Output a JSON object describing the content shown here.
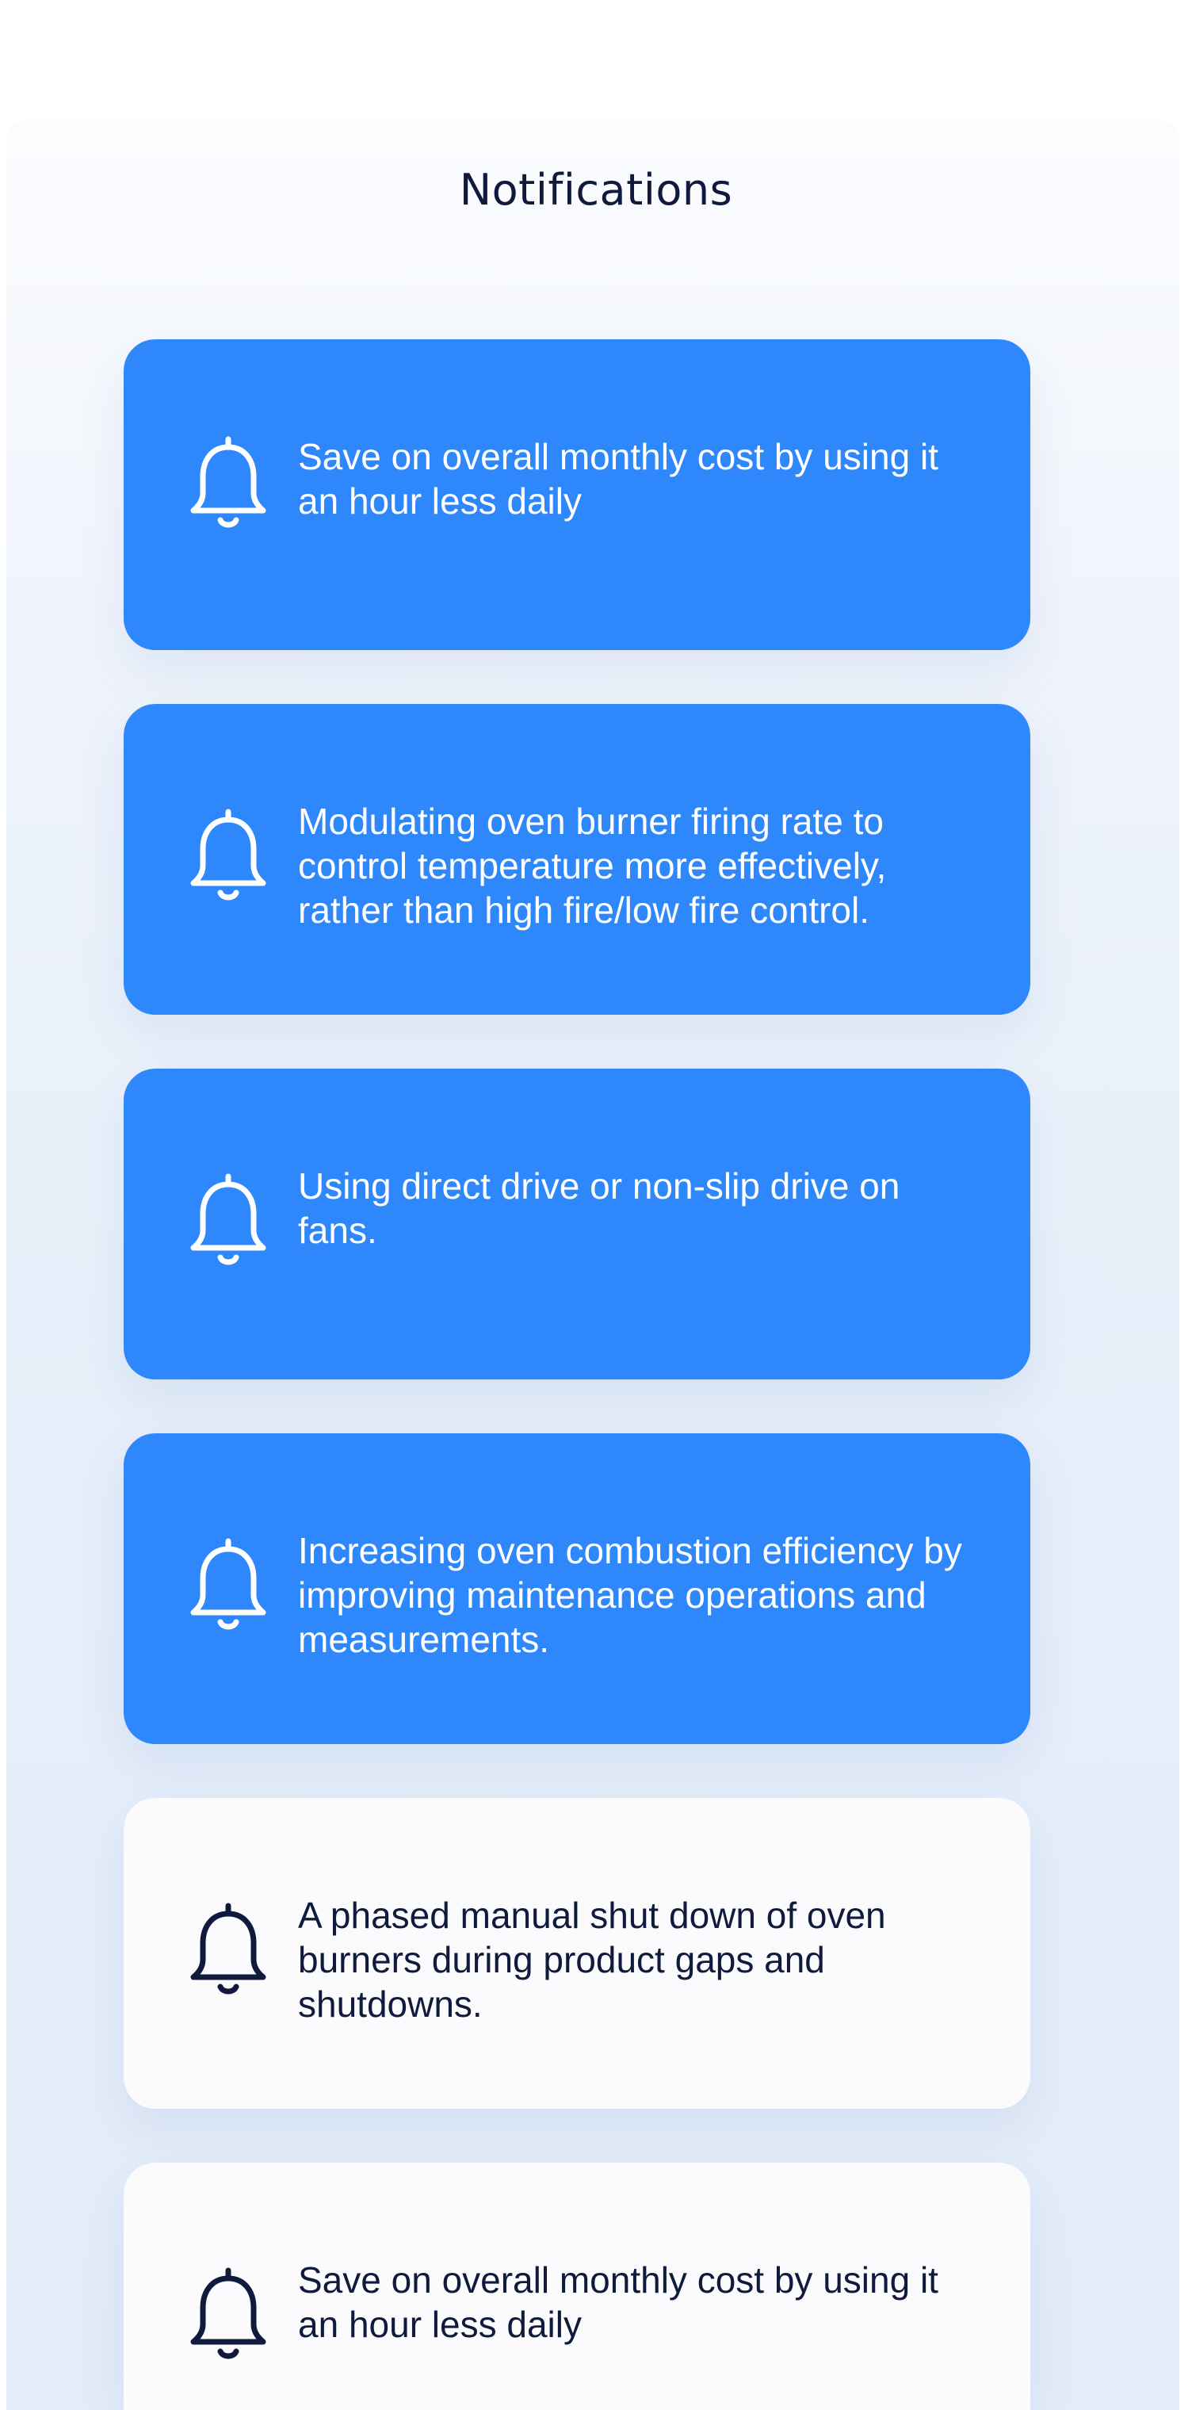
{
  "header": {
    "title": "Notifications"
  },
  "colors": {
    "accent": "#2f88fb",
    "text_dark": "#0f1a3c",
    "card_read_bg": "#fbfbfd"
  },
  "notifications": [
    {
      "message": "Save on overall monthly cost by using it an hour less daily",
      "state": "unread",
      "icon": "bell-icon"
    },
    {
      "message": "Modulating oven burner firing rate to control temperature more effectively, rather than high fire/low fire control.",
      "state": "unread",
      "icon": "bell-icon"
    },
    {
      "message": "Using direct drive or non-slip drive on fans.",
      "state": "unread",
      "icon": "bell-icon"
    },
    {
      "message": "Increasing oven combustion efficiency by improving maintenance operations and measurements.",
      "state": "unread",
      "icon": "bell-icon"
    },
    {
      "message": "A phased manual shut down of oven burners during product gaps and shutdowns.",
      "state": "read",
      "icon": "bell-icon"
    },
    {
      "message": "Save on overall monthly cost by using it an hour less daily",
      "state": "read",
      "icon": "bell-icon"
    }
  ]
}
